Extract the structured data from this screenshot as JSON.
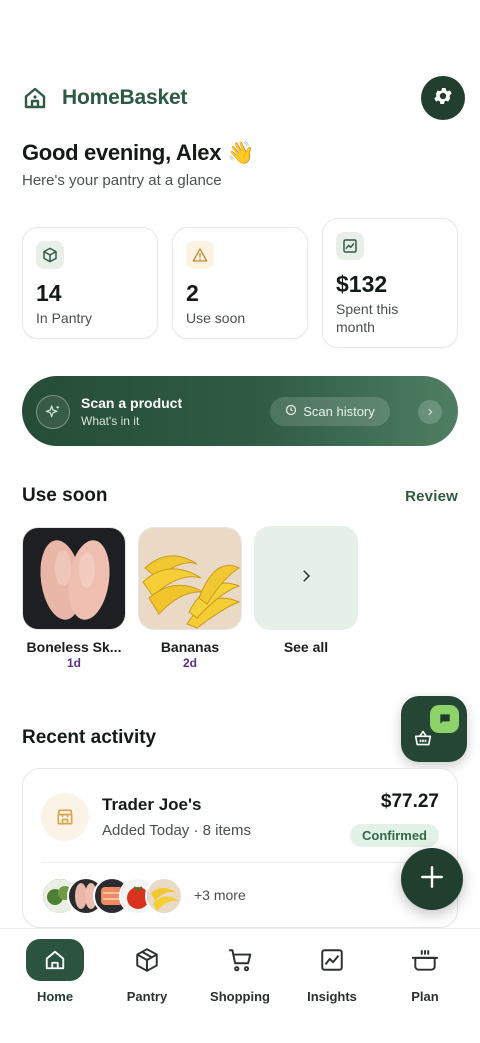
{
  "header": {
    "brand": "HomeBasket",
    "logo_icon": "home-icon",
    "settings_icon": "gear-icon"
  },
  "greeting": {
    "title": "Good evening, Alex 👋",
    "subtitle": "Here's your pantry at a glance"
  },
  "stats": [
    {
      "value": "14",
      "label": "In Pantry",
      "icon": "box-icon",
      "icon_bg": "#e8efe9",
      "icon_color": "#2d5a42"
    },
    {
      "value": "2",
      "label": "Use soon",
      "icon": "warning-icon",
      "icon_bg": "#fdf3e1",
      "icon_color": "#c4893a"
    },
    {
      "value": "$132",
      "label": "Spent this month",
      "icon": "chart-icon",
      "icon_bg": "#e8efe9",
      "icon_color": "#2d5a42"
    }
  ],
  "scan": {
    "title": "Scan a product",
    "subtitle": "What's in it",
    "history_label": "Scan history"
  },
  "use_soon": {
    "title": "Use soon",
    "action": "Review",
    "items": [
      {
        "name": "Boneless Sk...",
        "days": "1d"
      },
      {
        "name": "Bananas",
        "days": "2d"
      }
    ],
    "see_all": "See all"
  },
  "recent": {
    "title": "Recent activity",
    "store": "Trader Joe's",
    "meta": "Added Today · 8 items",
    "amount": "$77.27",
    "status": "Confirmed",
    "more": "+3 more"
  },
  "tabs": [
    {
      "label": "Home",
      "icon": "home-icon",
      "active": true
    },
    {
      "label": "Pantry",
      "icon": "box-icon"
    },
    {
      "label": "Shopping",
      "icon": "cart-icon"
    },
    {
      "label": "Insights",
      "icon": "chart-icon"
    },
    {
      "label": "Plan",
      "icon": "pot-icon"
    }
  ],
  "colors": {
    "brand": "#2d5a42",
    "dark": "#213f2f",
    "accent_green": "#8ed36a",
    "days_purple": "#5b2d8a"
  }
}
